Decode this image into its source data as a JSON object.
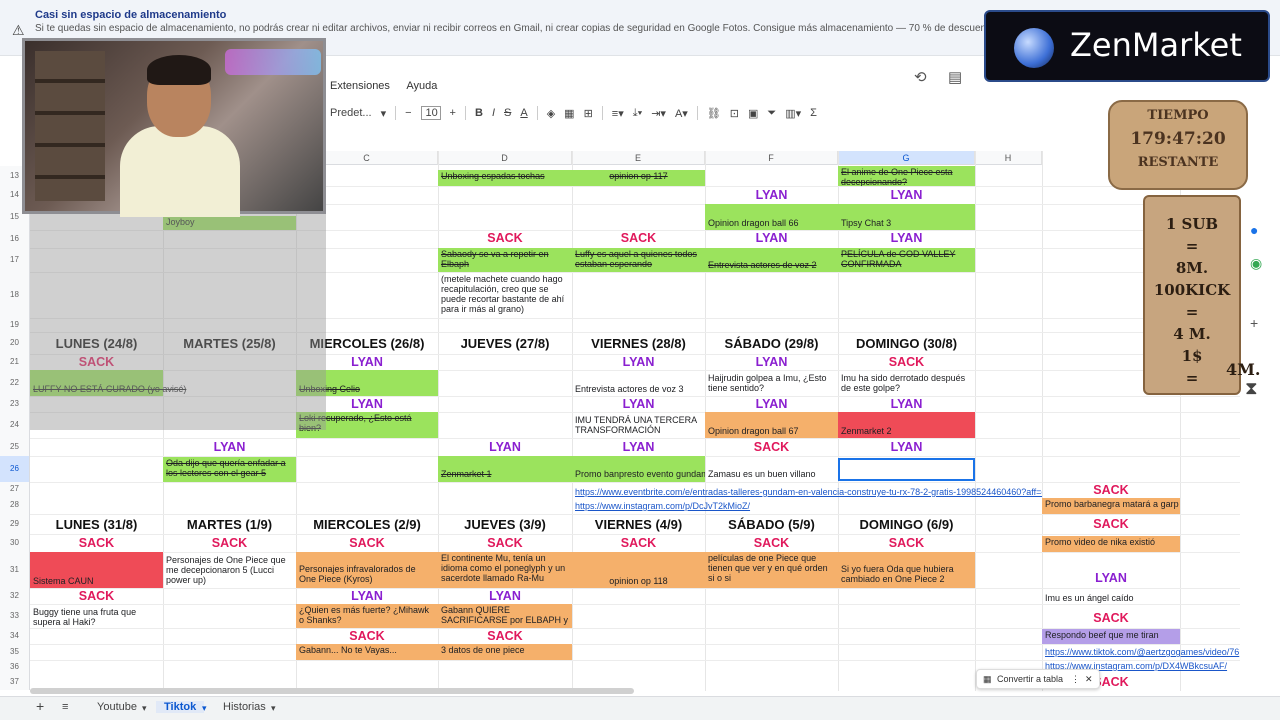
{
  "banner": {
    "title": "Casi sin espacio de almacenamiento",
    "message": "Si te quedas sin espacio de almacenamiento, no podrás crear ni editar archivos, enviar ni recibir correos en Gmail, ni crear copias de seguridad en Google Fotos. Consigue más almacenamiento — 70 % de descuento durante 3"
  },
  "menu": {
    "extensions": "Extensiones",
    "help": "Ayuda"
  },
  "toolbar": {
    "font": "Predet...",
    "font_size": "10",
    "bold": "B",
    "italic": "I",
    "strike": "S",
    "text_color": "A",
    "sum": "Σ"
  },
  "columns": [
    "C",
    "D",
    "E",
    "F",
    "G",
    "H"
  ],
  "rows": [
    "13",
    "14",
    "15",
    "16",
    "17",
    "18",
    "19",
    "20",
    "21",
    "22",
    "23",
    "24",
    "25",
    "26",
    "27",
    "28",
    "29",
    "30",
    "31",
    "32",
    "33",
    "34",
    "35",
    "36",
    "37"
  ],
  "week1": {
    "days": [
      "LUNES (24/8)",
      "MARTES (25/8)",
      "MIERCOLES (26/8)",
      "JUEVES (27/8)",
      "VIERNES (28/8)",
      "SÁBADO (29/8)",
      "DOMINGO (30/8)"
    ]
  },
  "week2": {
    "days": [
      "LUNES (31/8)",
      "MARTES (1/9)",
      "MIERCOLES (2/9)",
      "JUEVES (3/9)",
      "VIERNES (4/9)",
      "SÁBADO (5/9)",
      "DOMINGO (6/9)"
    ]
  },
  "labels": {
    "sack": "SACK",
    "lyan": "LYAN"
  },
  "cells": {
    "r13d": "Unboxing espadas tochas",
    "r13e": "opinion op 117",
    "r13g": "El anime de One Piece esta decepcionando?",
    "r15b": "Joyboy",
    "r15f": "Opinion dragon ball 66",
    "r15g": "Tipsy Chat 3",
    "r17d": "Sabaody se va a repetir en Elbaph",
    "r17e": "Luffy es aquel a quienes todos estaban esperando",
    "r17f": "Entrevista actores de voz 2",
    "r17g": "PELÍCULA de GOD VALLEY CONFIRMADA",
    "r18d": "(metele machete cuando hago recapitulación, creo que se puede recortar bastante de ahí para ir más al grano)",
    "r22a": "LUFFY NO ESTÁ CURADO (yo avisé)",
    "r22c": "Unboxing Celio",
    "r22e": "Entrevista actores de voz 3",
    "r22f": "Haijrudin golpea a Imu, ¿Esto tiene sentido?",
    "r22g": "Imu ha sido derrotado después de este golpe?",
    "r24c": "Loki recuperado, ¿Esto está bien?",
    "r24e": "IMU TENDRÁ UNA TERCERA TRANSFORMACIÓN",
    "r24f": "Opinion dragon ball 67",
    "r24g": "Zenmarket 2",
    "r26b": "Oda dijo que quería enfadar a los lectores con el gear 5",
    "r26d": "Zenmarket 1",
    "r26e": "Promo banpresto evento gundam",
    "r26f": "Zamasu es un buen villano",
    "r27link": "https://www.eventbrite.com/e/entradas-talleres-gundam-en-valencia-construye-tu-rx-78-2-gratis-1998524460460?aff=o",
    "r28link": "https://www.instagram.com/p/DcJvT2kMioZ/",
    "r28h": "Promo barbanegra matará a garp",
    "r30h": "Promo video de nika existió",
    "r31a": "Sistema CAUN",
    "r31b": "Personajes de One Piece que me decepcionaron 5 (Lucci power up)",
    "r31c": "Personajes infravalorados de One Piece (Kyros)",
    "r31d": "El continente Mu, tenía un idioma como el poneglyph y un sacerdote llamado Ra-Mu",
    "r31e": "opinion op 118",
    "r31f": "películas de one Piece que tienen que ver y en qué orden si o si",
    "r31g": "Si yo fuera Oda que hubiera cambiado en One Piece 2",
    "r32h": "Imu es un ángel caído",
    "r33a": "Buggy tiene una fruta que supera al Haki?",
    "r33c": "¿Quien es más fuerte? ¿Mihawk o Shanks?",
    "r33d": "Gabann QUIERE SACRIFICARSE por ELBAPH y",
    "r34h": "Respondo beef que me tiran",
    "r35c": "Gabann... No te Vayas...",
    "r35d": "3 datos de one piece",
    "r35hlink": "https://www.tiktok.com/@aertzgogames/video/76",
    "r36hlink": "https://www.instagram.com/p/DX4WBkcsuAF/"
  },
  "convert_table": "Convertir a tabla",
  "sheets": [
    "Youtube",
    "Tiktok",
    "Historias"
  ],
  "active_sheet": "Tiktok",
  "overlay": {
    "brand": "ZenMarket",
    "timer_title": "TIEMPO",
    "timer": "179:47:20",
    "timer_sub": "RESTANTE",
    "rules": [
      "1 SUB",
      "=",
      "8M.",
      "100KICK",
      "=",
      "4 M.",
      "1$",
      "=",
      "4M."
    ]
  },
  "colors": {
    "green": "#9be35d",
    "orange": "#f5b06b",
    "red": "#ef4b57",
    "purple": "#b49ee8",
    "sack": "#e0195c",
    "lyan": "#8a1fd0"
  }
}
